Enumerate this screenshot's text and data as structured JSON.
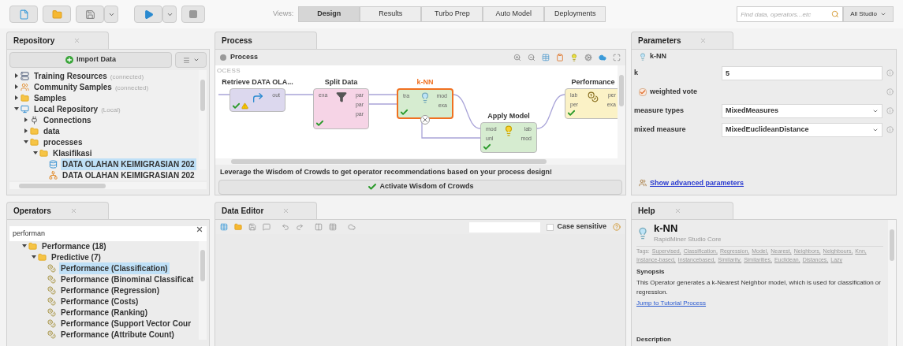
{
  "toolbar": {
    "views_label": "Views:",
    "views": [
      {
        "label": "Design",
        "selected": true
      },
      {
        "label": "Results",
        "selected": false
      },
      {
        "label": "Turbo Prep",
        "selected": false
      },
      {
        "label": "Auto Model",
        "selected": false
      },
      {
        "label": "Deployments",
        "selected": false
      }
    ],
    "search": {
      "placeholder": "Find data, operators...etc"
    },
    "scope": "All Studio"
  },
  "repository": {
    "title": "Repository",
    "import_button": "Import Data",
    "tree": [
      {
        "label": "Training Resources",
        "note": "(connected)",
        "kind": "server",
        "expanded": false,
        "selected": false
      },
      {
        "label": "Community Samples",
        "note": "(connected)",
        "kind": "people",
        "expanded": false,
        "selected": false
      },
      {
        "label": "Samples",
        "kind": "folder",
        "expanded": false,
        "selected": false
      },
      {
        "label": "Local Repository",
        "note": "(Local)",
        "kind": "computer",
        "expanded": true,
        "selected": false,
        "children": [
          {
            "label": "Connections",
            "kind": "plug",
            "expanded": false,
            "selected": false
          },
          {
            "label": "data",
            "kind": "folder",
            "expanded": false,
            "selected": false
          },
          {
            "label": "processes",
            "kind": "folder",
            "expanded": true,
            "selected": false,
            "children": [
              {
                "label": "Klasifikasi",
                "kind": "folder",
                "expanded": true,
                "selected": false,
                "children": [
                  {
                    "label": "DATA OLAHAN KEIMIGRASIAN 202",
                    "kind": "data",
                    "selected": true
                  },
                  {
                    "label": "DATA OLAHAN KEIMIGRASIAN 202",
                    "kind": "process",
                    "selected": false
                  }
                ]
              }
            ]
          }
        ]
      }
    ]
  },
  "process": {
    "title": "Process",
    "breadcrumb": "Process",
    "canvas_label": "OCESS",
    "nodes": [
      {
        "title": "Retrieve DATA OLA...",
        "kind": "retrieve",
        "selected": false,
        "ok": true,
        "warning": true,
        "out_ports": [
          "out"
        ]
      },
      {
        "title": "Split Data",
        "kind": "split",
        "selected": false,
        "ok": true,
        "warning": false,
        "in_ports": [
          "exa"
        ],
        "out_ports": [
          "par",
          "par",
          "par"
        ]
      },
      {
        "title": "k-NN",
        "kind": "model",
        "selected": true,
        "ok": true,
        "warning": false,
        "in_ports": [
          "tra"
        ],
        "out_ports": [
          "mod",
          "exa"
        ]
      },
      {
        "title": "Apply Model",
        "kind": "apply",
        "selected": false,
        "ok": true,
        "warning": false,
        "in_ports": [
          "mod",
          "unl"
        ],
        "out_ports": [
          "lab",
          "mod"
        ]
      },
      {
        "title": "Performance",
        "kind": "performance",
        "selected": false,
        "ok": true,
        "warning": false,
        "in_ports": [
          "lab",
          "per"
        ],
        "out_ports": [
          "per",
          "exa"
        ]
      }
    ],
    "hint": "Leverage the Wisdom of Crowds to get operator recommendations based on your process design!",
    "activate_button": "Activate Wisdom of Crowds"
  },
  "parameters": {
    "title": "Parameters",
    "operator": "k-NN",
    "rows": [
      {
        "kind": "text",
        "label": "k",
        "value": "5"
      },
      {
        "kind": "checkbox",
        "label": "weighted vote",
        "checked": true
      },
      {
        "kind": "select",
        "label": "measure types",
        "value": "MixedMeasures"
      },
      {
        "kind": "select",
        "label": "mixed measure",
        "value": "MixedEuclideanDistance"
      }
    ],
    "advanced_link": "Show advanced parameters"
  },
  "operators": {
    "title": "Operators",
    "search": "performan",
    "tree": [
      {
        "label": "Performance (18)",
        "kind": "folder",
        "expanded": true,
        "selected": false,
        "children": [
          {
            "label": "Predictive (7)",
            "kind": "folder",
            "expanded": true,
            "selected": false,
            "children": [
              {
                "label": "Performance (Classification)",
                "kind": "operator",
                "selected": true
              },
              {
                "label": "Performance (Binominal Classificat",
                "kind": "operator",
                "selected": false
              },
              {
                "label": "Performance (Regression)",
                "kind": "operator",
                "selected": false
              },
              {
                "label": "Performance (Costs)",
                "kind": "operator",
                "selected": false
              },
              {
                "label": "Performance (Ranking)",
                "kind": "operator",
                "selected": false
              },
              {
                "label": "Performance (Support Vector Cour",
                "kind": "operator",
                "selected": false
              },
              {
                "label": "Performance (Attribute Count)",
                "kind": "operator",
                "selected": false
              }
            ]
          }
        ]
      }
    ]
  },
  "data_editor": {
    "title": "Data Editor",
    "case_sensitive": {
      "label": "Case sensitive",
      "checked": false
    }
  },
  "help": {
    "title": "Help",
    "operator": "k-NN",
    "source": "RapidMiner Studio Core",
    "tags_label": "Tags:",
    "tags": [
      "Supervised,",
      "Classification,",
      "Regression,",
      "Model,",
      "Nearest,",
      "Neighbors,",
      "Neighbours,",
      "Knn,",
      "Instance-based,",
      "Instancebased,",
      "Similarity,",
      "Similarities,",
      "Euclidean,",
      "Distances,",
      "Lazy"
    ],
    "synopsis_heading": "Synopsis",
    "synopsis": "This Operator generates a k-Nearest Neighbor model, which is used for classification or regression.",
    "tutorial_link": "Jump to Tutorial Process",
    "description_heading": "Description"
  }
}
